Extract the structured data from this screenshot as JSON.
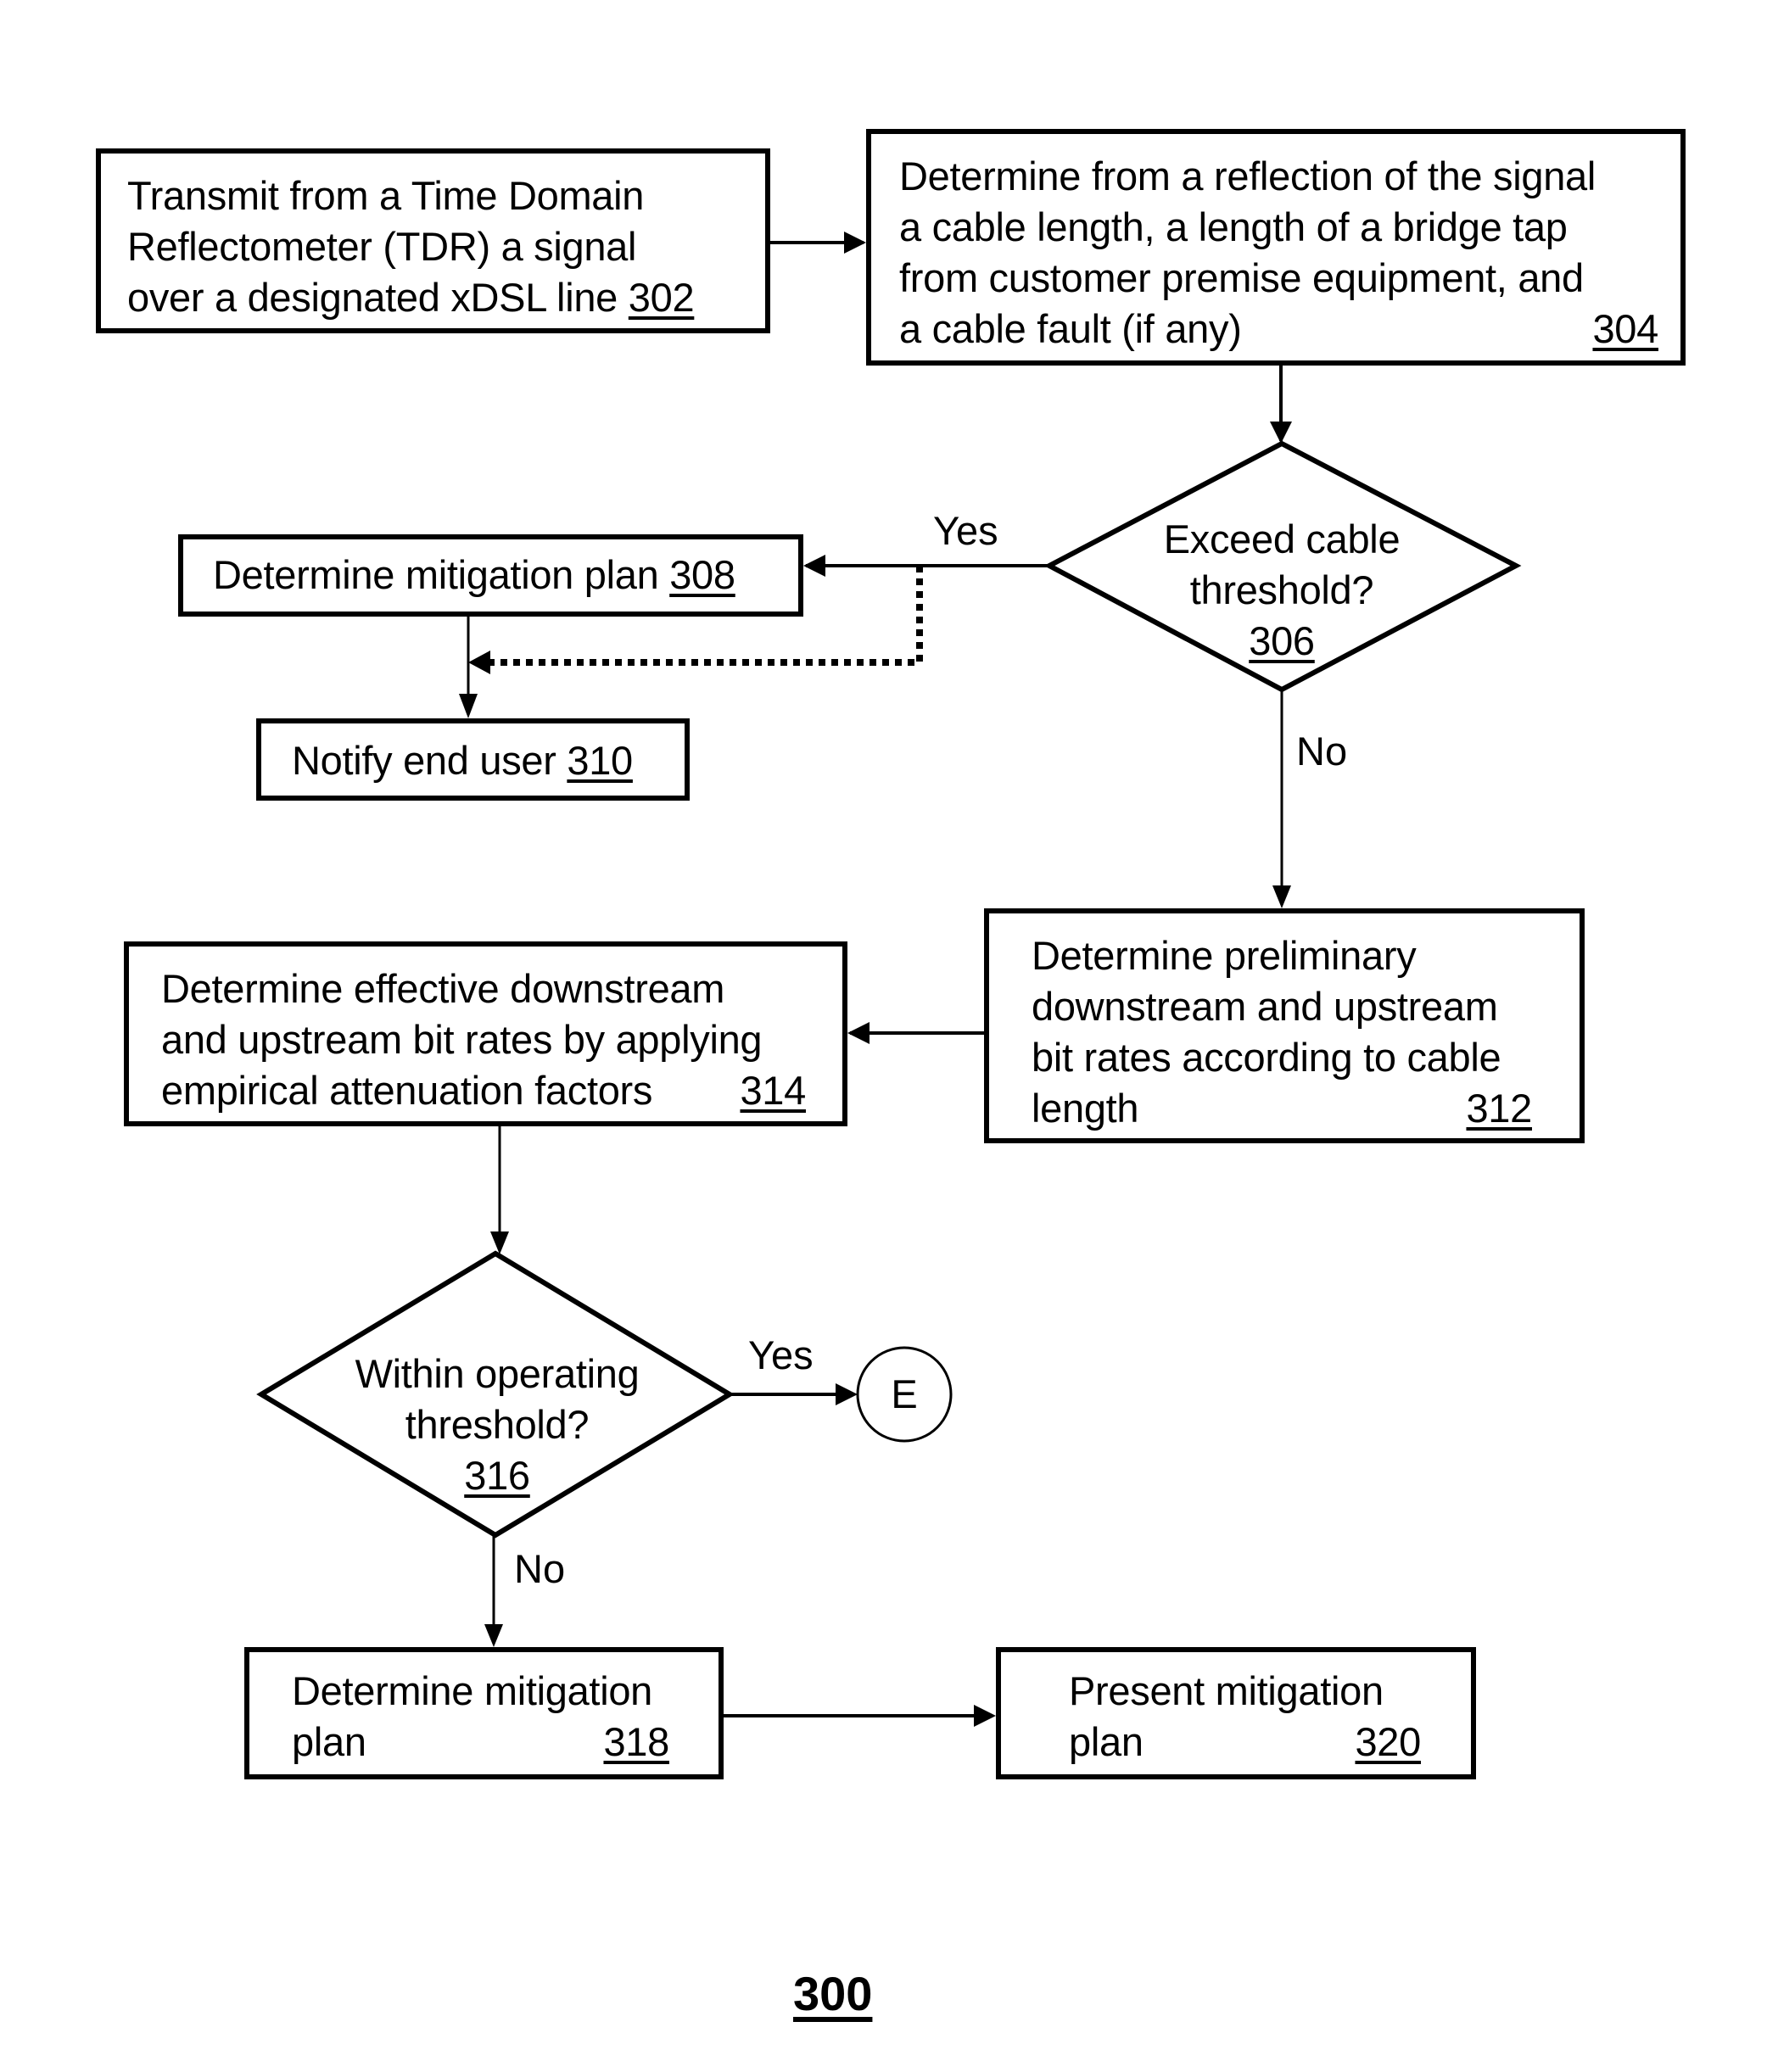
{
  "figure_number": "300",
  "steps": {
    "s302": {
      "lines": [
        "Transmit from a Time Domain",
        "Reflectometer (TDR) a signal",
        "over a designated xDSL line"
      ],
      "ref": "302"
    },
    "s304": {
      "lines": [
        "Determine from a reflection of the signal",
        "a cable length, a length of a bridge tap",
        "from customer premise equipment, and",
        "a cable fault (if any)"
      ],
      "ref": "304"
    },
    "s306": {
      "lines": [
        "Exceed cable",
        "threshold?"
      ],
      "ref": "306"
    },
    "s308": {
      "text": "Determine mitigation plan",
      "ref": "308"
    },
    "s310": {
      "text": "Notify end user",
      "ref": "310"
    },
    "s312": {
      "lines": [
        "Determine preliminary",
        "downstream and upstream",
        "bit rates according to cable",
        "length"
      ],
      "ref": "312"
    },
    "s314": {
      "lines": [
        "Determine effective downstream",
        "and upstream bit rates by applying",
        "empirical attenuation factors"
      ],
      "ref": "314"
    },
    "s316": {
      "lines": [
        "Within operating",
        "threshold?"
      ],
      "ref": "316"
    },
    "s318": {
      "lines": [
        "Determine mitigation",
        "plan"
      ],
      "ref": "318"
    },
    "s320": {
      "lines": [
        "Present mitigation",
        "plan"
      ],
      "ref": "320"
    }
  },
  "edge_labels": {
    "d306_yes": "Yes",
    "d306_no": "No",
    "d316_yes": "Yes",
    "d316_no": "No"
  },
  "connector": {
    "label": "E"
  }
}
